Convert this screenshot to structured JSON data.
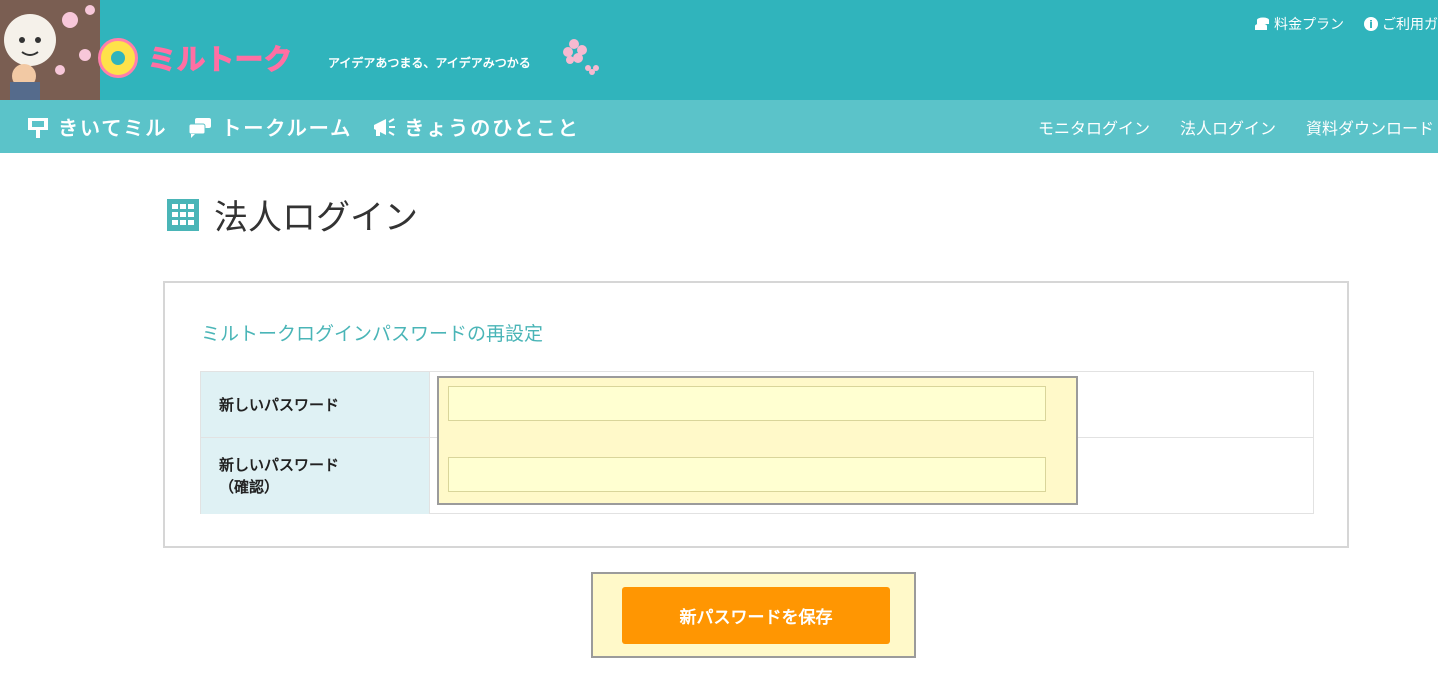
{
  "header": {
    "logo_text": "ミルトーク",
    "tagline": "アイデアあつまる、アイデアみつかる",
    "top_links": [
      {
        "label": "料金プラン",
        "icon": "coins-icon"
      },
      {
        "label": "ご利用ガ",
        "icon": "info-icon"
      }
    ]
  },
  "nav": {
    "left_items": [
      {
        "label": "きいてミル",
        "icon": "signboard-icon"
      },
      {
        "label": "トークルーム",
        "icon": "chat-bubbles-icon"
      },
      {
        "label": "きょうのひとこと",
        "icon": "megaphone-icon"
      }
    ],
    "right_items": [
      {
        "label": "モニタログイン"
      },
      {
        "label": "法人ログイン"
      },
      {
        "label": "資料ダウンロード"
      }
    ]
  },
  "page": {
    "title": "法人ログイン",
    "title_icon": "building-icon"
  },
  "form": {
    "heading": "ミルトークログインパスワードの再設定",
    "fields": [
      {
        "label": "新しいパスワード",
        "value": ""
      },
      {
        "label_line1": "新しいパスワード",
        "label_line2": "（確認）",
        "value": ""
      }
    ],
    "submit_label": "新パスワードを保存"
  },
  "colors": {
    "header_teal": "#30b4bc",
    "nav_teal": "#5bc3c9",
    "label_bg": "#dff1f4",
    "input_bg": "#ffffd1",
    "button_orange": "#ff9602",
    "heading_teal": "#4ab5b7"
  }
}
